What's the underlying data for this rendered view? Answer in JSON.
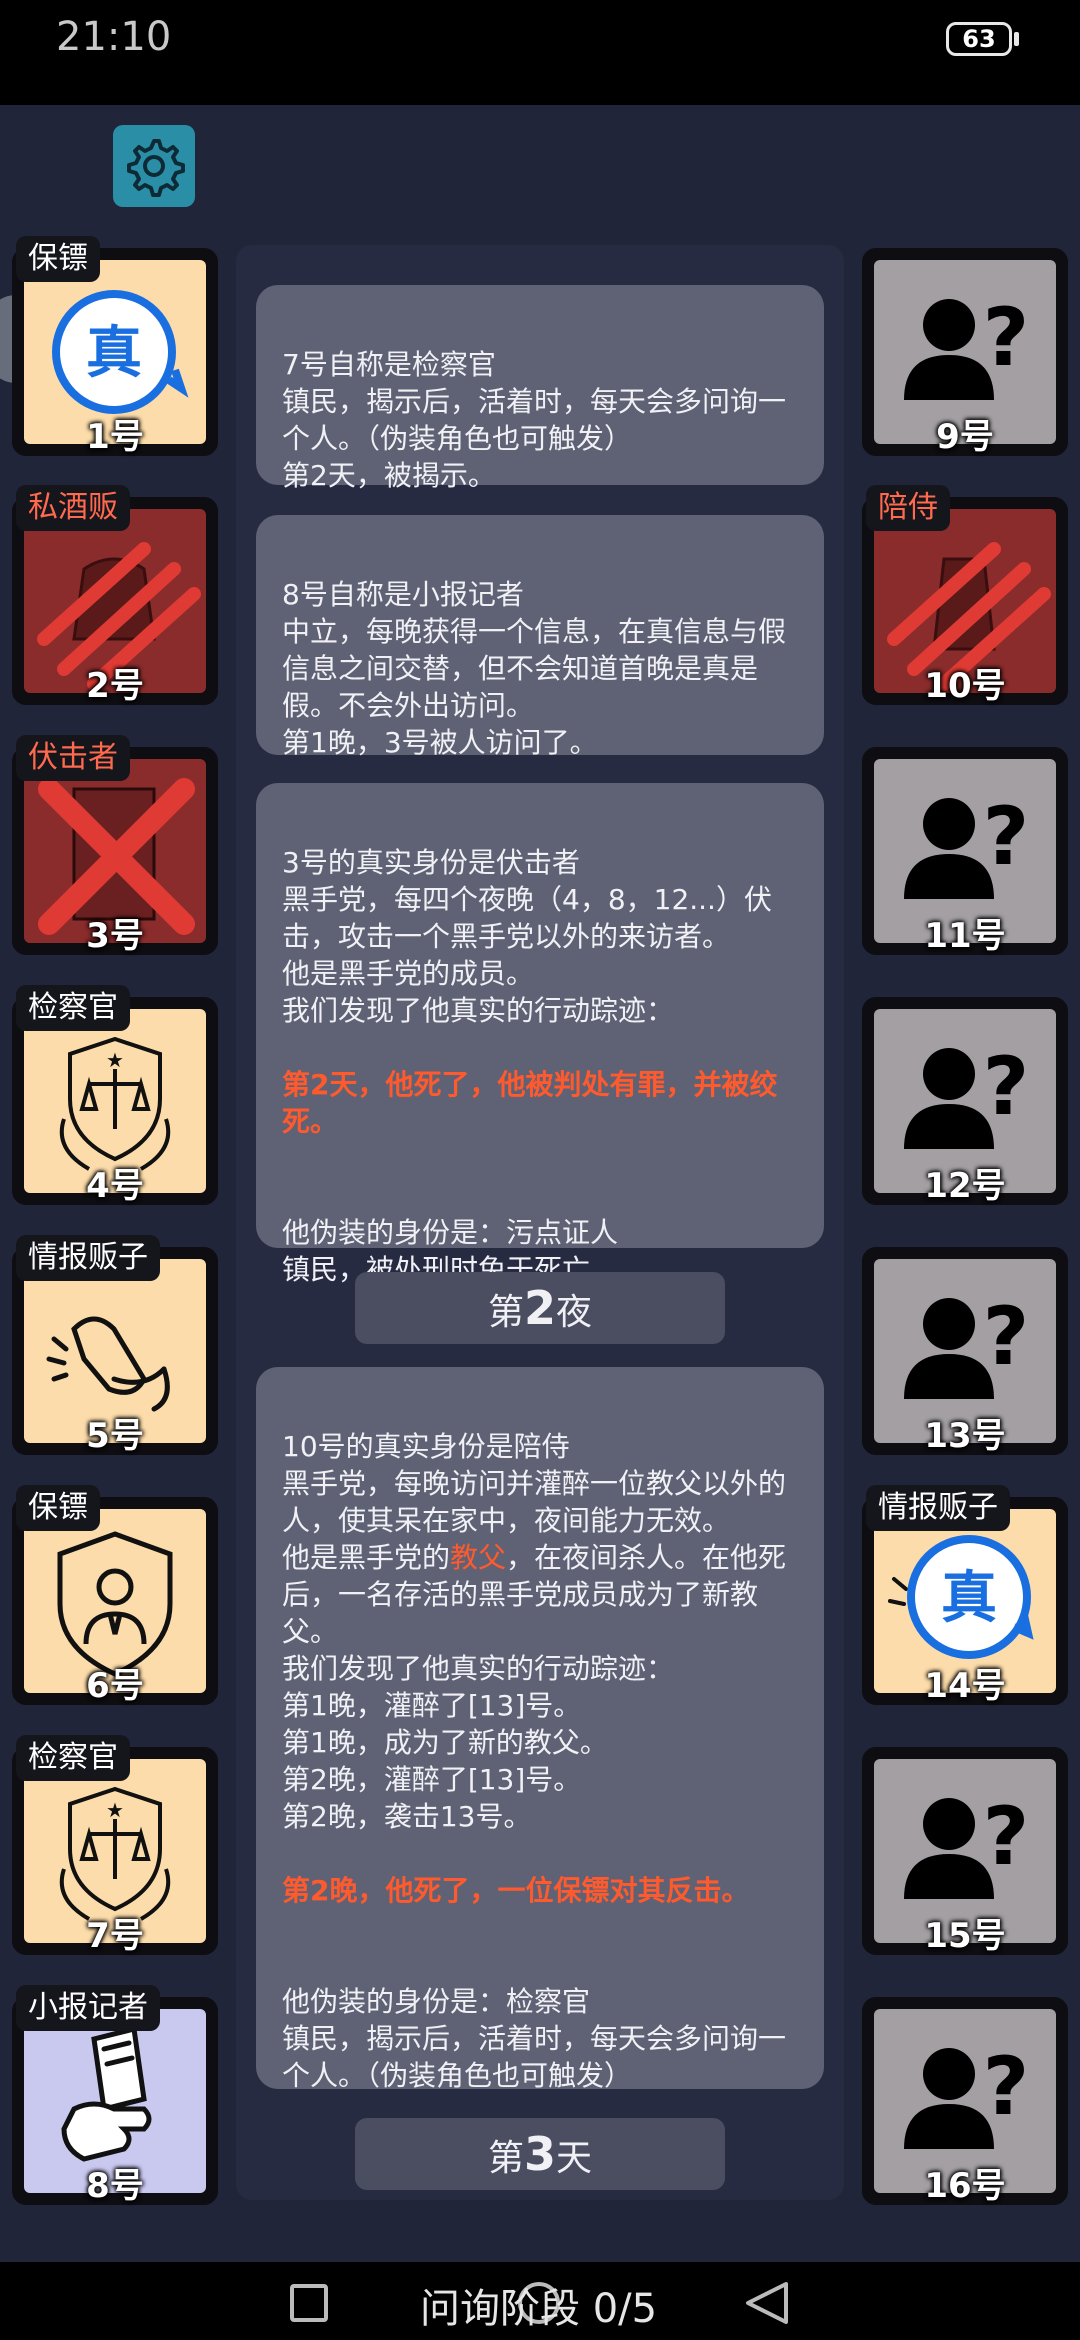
{
  "status": {
    "time": "21:10",
    "battery": "63"
  },
  "left_players": [
    {
      "num": "1号",
      "role": "保镖",
      "state": "revealed-true"
    },
    {
      "num": "2号",
      "role": "私酒贩",
      "state": "dead-claw"
    },
    {
      "num": "3号",
      "role": "伏击者",
      "state": "dead-cross"
    },
    {
      "num": "4号",
      "role": "检察官",
      "state": "alive"
    },
    {
      "num": "5号",
      "role": "情报贩子",
      "state": "alive"
    },
    {
      "num": "6号",
      "role": "保镖",
      "state": "alive"
    },
    {
      "num": "7号",
      "role": "检察官",
      "state": "alive"
    },
    {
      "num": "8号",
      "role": "小报记者",
      "state": "alive"
    }
  ],
  "right_players": [
    {
      "num": "9号",
      "role": "",
      "state": "unknown"
    },
    {
      "num": "10号",
      "role": "陪侍",
      "state": "dead-claw"
    },
    {
      "num": "11号",
      "role": "",
      "state": "unknown"
    },
    {
      "num": "12号",
      "role": "",
      "state": "unknown"
    },
    {
      "num": "13号",
      "role": "",
      "state": "unknown"
    },
    {
      "num": "14号",
      "role": "情报贩子",
      "state": "revealed-true"
    },
    {
      "num": "15号",
      "role": "",
      "state": "unknown"
    },
    {
      "num": "16号",
      "role": "",
      "state": "unknown"
    }
  ],
  "cards": {
    "c1": "7号自称是检察官\n镇民，揭示后，活着时，每天会多问询一个人。（伪装角色也可触发）\n第2天，被揭示。",
    "c2": "8号自称是小报记者\n中立，每晚获得一个信息，在真信息与假信息之间交替，但不会知道首晚是真是假。不会外出访问。\n第1晚，3号被人访问了。",
    "c3_a": "3号的真实身份是伏击者\n黑手党，每四个夜晚（4，8，12...）伏击，攻击一个黑手党以外的来访者。\n他是黑手党的成员。\n我们发现了他真实的行动踪迹：",
    "c3_red": "第2天，他死了，他被判处有罪，并被绞死。",
    "c3_b": "他伪装的身份是：污点证人\n镇民，被处刑时免于死亡。",
    "c4_a": "10号的真实身份是陪侍\n黑手党，每晚访问并灌醉一位教父以外的人，使其呆在家中，夜间能力无效。\n他是黑手党的",
    "c4_godfather": "教父",
    "c4_b": "，在夜间杀人。在他死后，一名存活的黑手党成员成为了新教父。\n我们发现了他真实的行动踪迹：\n第1晚，灌醉了[13]号。\n第1晚，成为了新的教父。\n第2晚，灌醉了[13]号。\n第2晚，袭击13号。",
    "c4_red": "第2晚，他死了，一位保镖对其反击。",
    "c4_c": "他伪装的身份是：检察官\n镇民，揭示后，活着时，每天会多问询一个人。（伪装角色也可触发）"
  },
  "phases": {
    "night2_prefix": "第",
    "night2_num": "2",
    "night2_suffix": "夜",
    "day3_prefix": "第",
    "day3_num": "3",
    "day3_suffix": "天"
  },
  "footer": {
    "phase_label": "问询阶段 0/5"
  }
}
